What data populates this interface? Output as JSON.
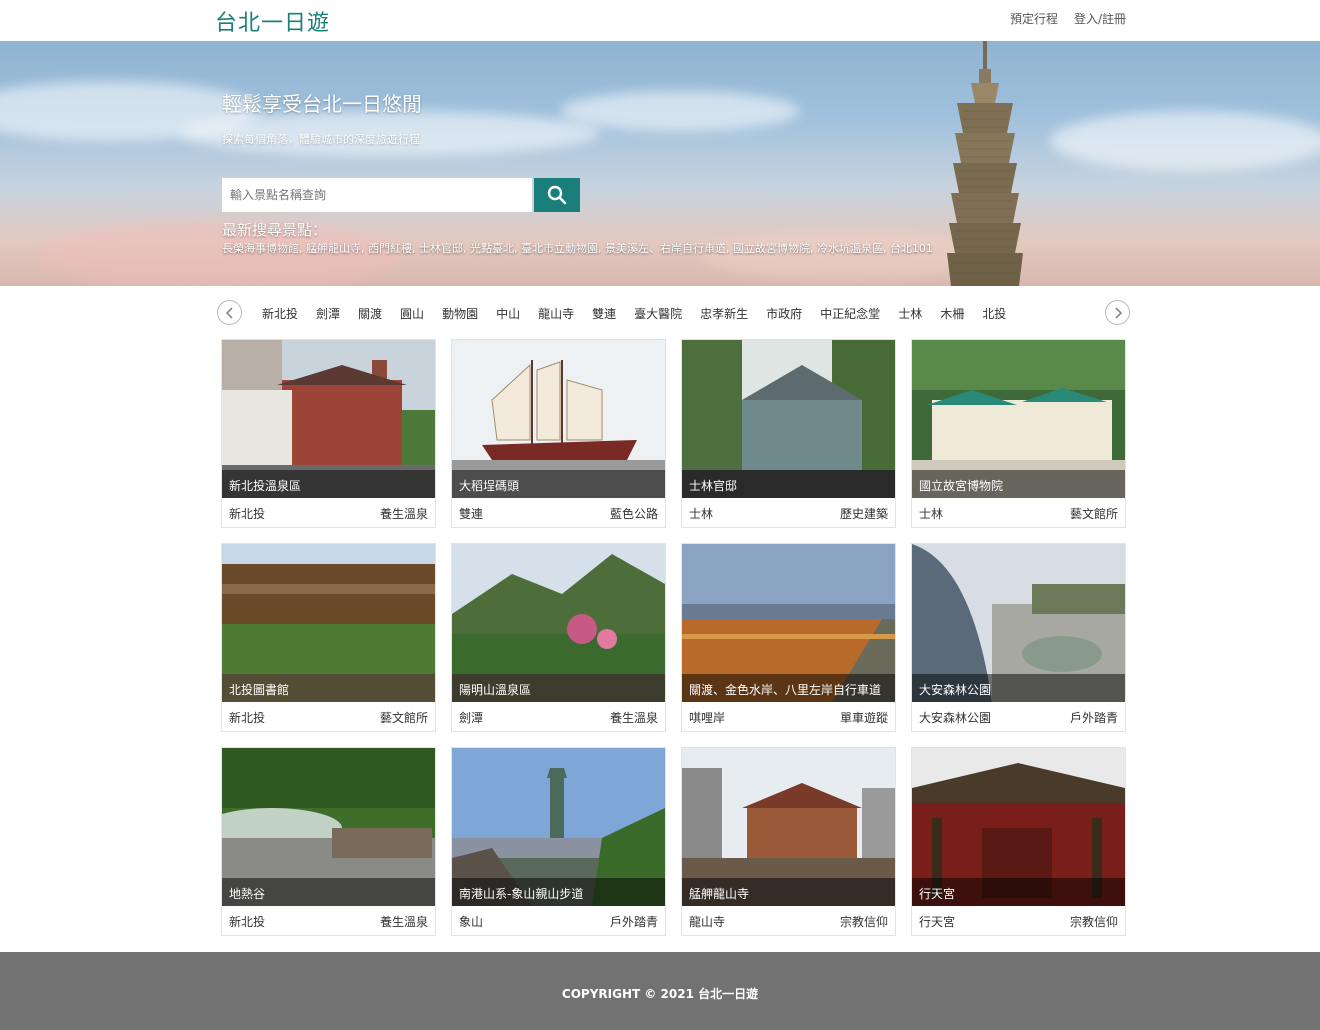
{
  "navbar": {
    "brand": "台北一日遊",
    "links": [
      "預定行程",
      "登入/註冊"
    ]
  },
  "hero": {
    "title": "輕鬆享受台北一日悠閒",
    "subtitle": "探索每個角落，體驗城市的深度旅遊行程",
    "search_placeholder": "輸入景點名稱查詢",
    "recent_title": "最新搜尋景點：",
    "recent_list": "長榮海事博物館, 艋舺龍山寺, 西門紅樓, 士林官邸, 光點臺北, 臺北市立動物園, 景美溪左、右岸自行車道, 國立故宮博物院, 冷水坑溫泉區, 台北101"
  },
  "categories": [
    "新北投",
    "劍潭",
    "關渡",
    "圓山",
    "動物園",
    "中山",
    "龍山寺",
    "雙連",
    "臺大醫院",
    "忠孝新生",
    "市政府",
    "中正紀念堂",
    "士林",
    "木柵",
    "北投"
  ],
  "cards": [
    {
      "name": "新北投溫泉區",
      "loc": "新北投",
      "tag": "養生溫泉",
      "img": "red-building"
    },
    {
      "name": "大稻埕碼頭",
      "loc": "雙連",
      "tag": "藍色公路",
      "img": "ship"
    },
    {
      "name": "士林官邸",
      "loc": "士林",
      "tag": "歷史建築",
      "img": "green-house"
    },
    {
      "name": "國立故宮博物院",
      "loc": "士林",
      "tag": "藝文館所",
      "img": "museum"
    },
    {
      "name": "北投圖書館",
      "loc": "新北投",
      "tag": "藝文館所",
      "img": "library"
    },
    {
      "name": "陽明山溫泉區",
      "loc": "劍潭",
      "tag": "養生溫泉",
      "img": "mountain-garden"
    },
    {
      "name": "關渡、金色水岸、八里左岸自行車道",
      "loc": "唭哩岸",
      "tag": "單車遊蹤",
      "img": "riverside"
    },
    {
      "name": "大安森林公園",
      "loc": "大安森林公園",
      "tag": "戶外踏青",
      "img": "park-station"
    },
    {
      "name": "地熱谷",
      "loc": "新北投",
      "tag": "養生溫泉",
      "img": "thermal-valley"
    },
    {
      "name": "南港山系-象山親山步道",
      "loc": "象山",
      "tag": "戶外踏青",
      "img": "taipei101"
    },
    {
      "name": "艋舺龍山寺",
      "loc": "龍山寺",
      "tag": "宗教信仰",
      "img": "temple"
    },
    {
      "name": "行天宮",
      "loc": "行天宮",
      "tag": "宗教信仰",
      "img": "temple-red"
    }
  ],
  "footer": {
    "copyright": "COPYRIGHT © 2021 台北一日遊"
  },
  "colors": {
    "accent": "#1a7f7a",
    "footer_bg": "#727272"
  }
}
